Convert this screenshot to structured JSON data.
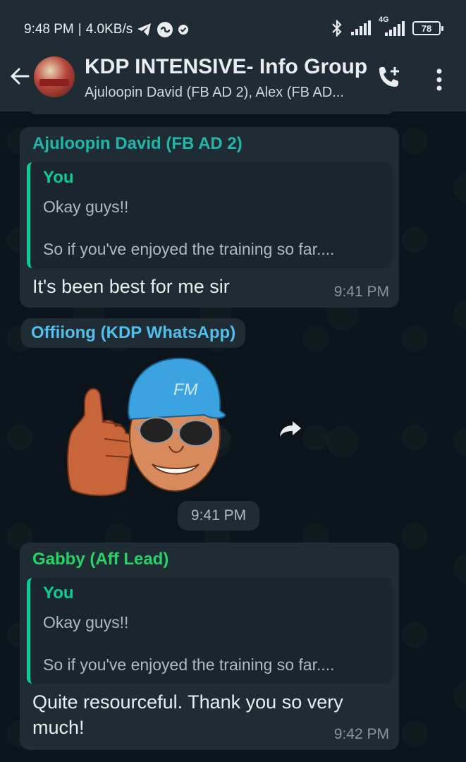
{
  "status_bar": {
    "time": "9:48 PM",
    "separator": "|",
    "speed": "4.0KB/s",
    "network_type": "4G",
    "battery": "78"
  },
  "header": {
    "title": "KDP INTENSIVE- Info Group",
    "members": "Ajuloopin David (FB AD 2), Alex (FB AD..."
  },
  "messages": [
    {
      "sender": "Ajuloopin David (FB AD 2)",
      "sender_color": "#1fb8a8",
      "quote": {
        "author": "You",
        "line1": "Okay guys!!",
        "line2": "So if you've enjoyed the training so far...."
      },
      "text": "It's been best for me sir",
      "time": "9:41 PM"
    },
    {
      "sender": "Offiiong (KDP WhatsApp)",
      "sender_color": "#53bdeb",
      "type": "sticker",
      "sticker_text": "FM",
      "time": "9:41 PM"
    },
    {
      "sender": "Gabby (Aff Lead)",
      "sender_color": "#25d366",
      "quote": {
        "author": "You",
        "line1": "Okay guys!!",
        "line2": "So if you've enjoyed the training so far...."
      },
      "text_line1": "Quite resourceful. Thank you so very",
      "text_line2": "much!",
      "time": "9:42 PM"
    }
  ],
  "colors": {
    "header_bg": "#1f2c33",
    "chat_bg": "#0b141a",
    "bubble_bg": "#202c33",
    "quote_bar": "#06cf9c"
  }
}
